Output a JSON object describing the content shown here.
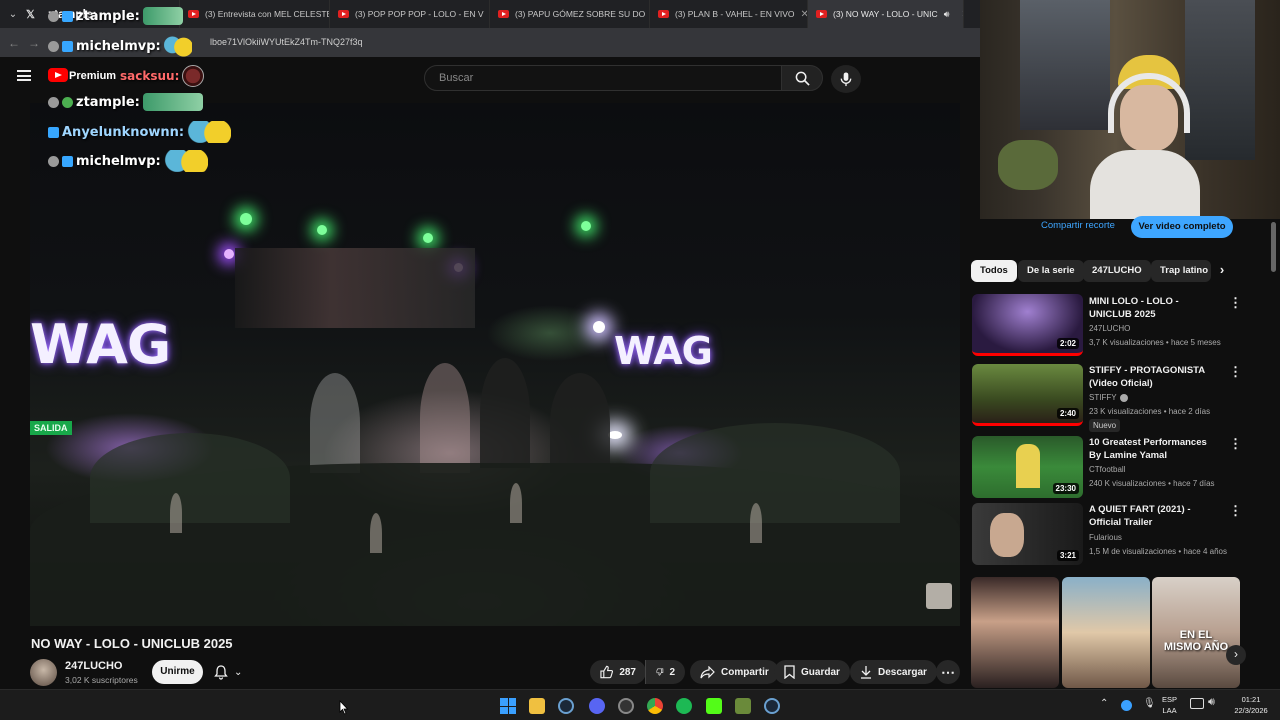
{
  "browser": {
    "tabs": [
      {
        "label": "ztample:",
        "active": false
      },
      {
        "label": "(3) Entrevista con MEL CELESTE",
        "active": false
      },
      {
        "label": "(3) POP POP POP - LOLO - EN V",
        "active": false
      },
      {
        "label": "(3) PAPU GÓMEZ SOBRE SU DO",
        "active": false
      },
      {
        "label": "(3) PLAN B - VAHEL - EN VIVO",
        "active": false
      },
      {
        "label": "(3) NO WAY - LOLO - UNIC",
        "active": true
      }
    ],
    "url": "lboe71VlOkiiWYUtEkZ4Tm-TNQ27f3q"
  },
  "youtube": {
    "premium_label": "Premium",
    "search_placeholder": "Buscar"
  },
  "chat": [
    {
      "user": "ztample:",
      "color": "#ffffff"
    },
    {
      "user": "michelmvp:",
      "color": "#ffffff"
    },
    {
      "user": "sacksuu:",
      "color": "#ff6a6a"
    },
    {
      "user": "ztample:",
      "color": "#ffffff"
    },
    {
      "user": "Anyelunknownn:",
      "color": "#9fd6ff"
    },
    {
      "user": "michelmvp:",
      "color": "#ffffff"
    }
  ],
  "video": {
    "title": "NO WAY - LOLO - UNICLUB 2025",
    "sign_left": "WAG",
    "sign_right": "WAG",
    "exit_sign": "SALIDA"
  },
  "channel": {
    "name": "247LUCHO",
    "subscribers": "3,02 K suscriptores",
    "join_label": "Unirme"
  },
  "actions": {
    "likes": "287",
    "dislikes": "2",
    "share": "Compartir",
    "save": "Guardar",
    "download": "Descargar"
  },
  "clip_actions": {
    "share_clip": "Compartir recorte",
    "watch_full": "Ver video completo"
  },
  "filter_chips": [
    {
      "label": "Todos",
      "selected": true
    },
    {
      "label": "De la serie",
      "selected": false
    },
    {
      "label": "247LUCHO",
      "selected": false
    },
    {
      "label": "Trap latino",
      "selected": false
    }
  ],
  "recommendations": [
    {
      "title": "MINI LOLO - LOLO - UNICLUB 2025",
      "channel": "247LUCHO",
      "meta": "3,7 K visualizaciones • hace 5 meses",
      "duration": "2:02",
      "badge": ""
    },
    {
      "title": "STIFFY - PROTAGONISTA (Video Oficial)",
      "channel": "STIFFY",
      "meta": "23 K visualizaciones • hace 2 días",
      "duration": "2:40",
      "badge": "Nuevo"
    },
    {
      "title": "10 Greatest Performances By Lamine Yamal",
      "channel": "CTfootball",
      "meta": "240 K visualizaciones • hace 7 días",
      "duration": "23:30",
      "badge": ""
    },
    {
      "title": "A QUIET FART (2021) - Official Trailer",
      "channel": "Fularious",
      "meta": "1,5 M de visualizaciones • hace 4 años",
      "duration": "3:21",
      "badge": ""
    }
  ],
  "shorts": [
    {
      "caption": ""
    },
    {
      "caption": ""
    },
    {
      "caption": "EN EL MISMO AÑO"
    }
  ],
  "taskbar": {
    "lang_top": "ESP",
    "lang_bottom": "LAA",
    "time": "01:21",
    "date": "22/3/2026"
  },
  "colors": {
    "background": "#0f0f0f",
    "accent_blue": "#3ea6ff",
    "youtube_red": "#ff0000"
  }
}
